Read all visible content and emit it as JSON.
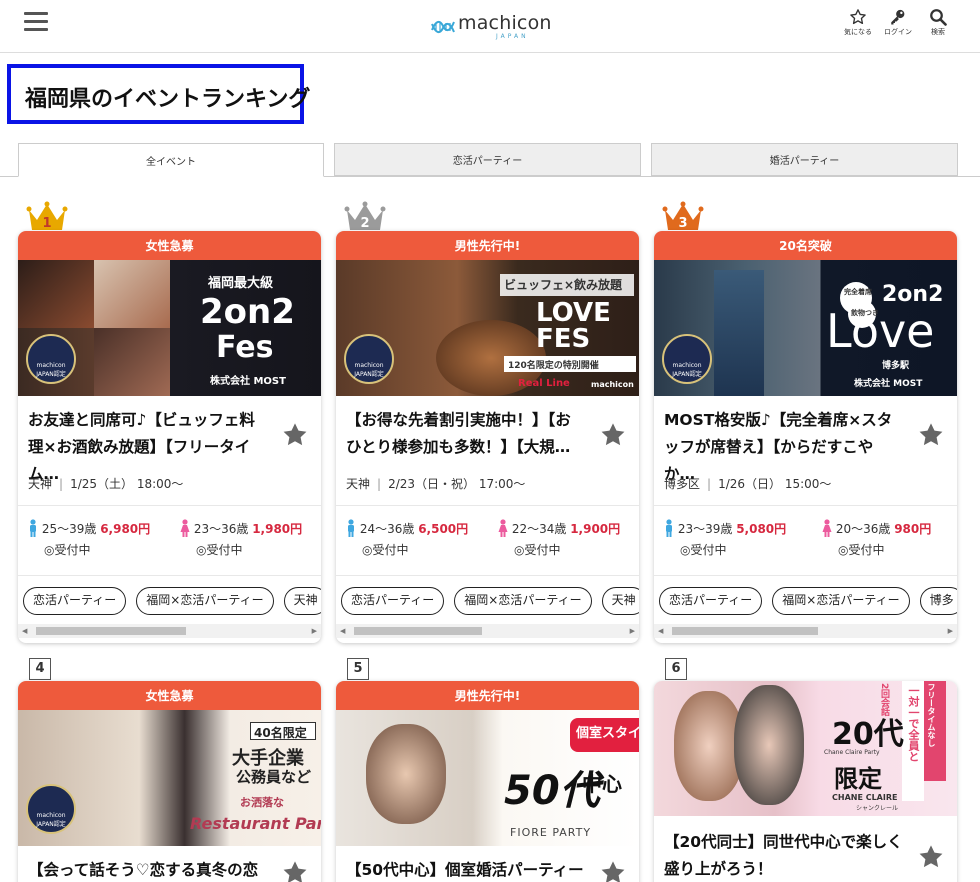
{
  "header": {
    "logo_text": "machicon",
    "logo_sub": "JAPAN",
    "icons": [
      {
        "name": "star-icon",
        "label": "気になる"
      },
      {
        "name": "key-icon",
        "label": "ログイン"
      },
      {
        "name": "search-icon",
        "label": "検索"
      }
    ]
  },
  "page_title": "福岡県のイベントランキング",
  "tabs": [
    {
      "label": "全イベント",
      "active": true
    },
    {
      "label": "恋活パーティー",
      "active": false
    },
    {
      "label": "婚活パーティー",
      "active": false
    }
  ],
  "cert_badge": {
    "line1": "machicon",
    "line2": "JAPAN認定"
  },
  "cards": [
    {
      "rank": "1",
      "banner": "女性急募",
      "image_text": [
        "福岡最大級",
        "2on2",
        "Fes",
        "株式会社 MOST"
      ],
      "title": "お友達と同席可♪【ビュッフェ料理×お酒飲み放題】【フリータイム…",
      "area": "天神",
      "date": "1/25（土） 18:00〜",
      "male_age": "25〜39歳",
      "male_price": "6,980円",
      "male_status": "◎受付中",
      "female_age": "23〜36歳",
      "female_price": "1,980円",
      "female_status": "◎受付中",
      "tags": [
        "恋活パーティー",
        "福岡×恋活パーティー",
        "天神"
      ]
    },
    {
      "rank": "2",
      "banner": "男性先行中!",
      "image_text": [
        "ビュッフェ×飲み放題",
        "LOVE",
        "FES",
        "120名限定の特別開催",
        "Real Line",
        "machicon"
      ],
      "title": "【お得な先着割引実施中！】【おひとり様参加も多数！】【大規…",
      "area": "天神",
      "date": "2/23（日・祝） 17:00〜",
      "male_age": "24〜36歳",
      "male_price": "6,500円",
      "male_status": "◎受付中",
      "female_age": "22〜34歳",
      "female_price": "1,900円",
      "female_status": "◎受付中",
      "tags": [
        "恋活パーティー",
        "福岡×恋活パーティー",
        "天神"
      ]
    },
    {
      "rank": "3",
      "banner": "20名突破",
      "image_text": [
        "完全着席",
        "飲物つき",
        "2on2",
        "Love",
        "博多駅",
        "株式会社 MOST"
      ],
      "title": "MOST格安版♪【完全着席×スタッフが席替え】【からだすこやか…",
      "area": "博多区",
      "date": "1/26（日） 15:00〜",
      "male_age": "23〜39歳",
      "male_price": "5,080円",
      "male_status": "◎受付中",
      "female_age": "20〜36歳",
      "female_price": "980円",
      "female_status": "◎受付中",
      "tags": [
        "恋活パーティー",
        "福岡×恋活パーティー",
        "博多"
      ]
    },
    {
      "rank": "4",
      "banner": "女性急募",
      "image_text": [
        "40名限定",
        "大手企業",
        "公務員など",
        "お洒落な",
        "Restaurant Party"
      ],
      "title": "【会って話そう♡恋する真冬の恋"
    },
    {
      "rank": "5",
      "banner": "男性先行中!",
      "image_text": [
        "個室スタイル",
        "50代",
        "中心",
        "FIORE PARTY"
      ],
      "title": "【50代中心】個室婚活パーティー"
    },
    {
      "rank": "6",
      "banner": "",
      "image_text": [
        "フリータイムなし",
        "一対一で全員と",
        "2回会話",
        "20代",
        "Chane Claire Party",
        "限定",
        "CHANE CLAIRE",
        "シャンクレール"
      ],
      "title": "【20代同士】同世代中心で楽しく盛り上がろう！"
    }
  ],
  "colors": {
    "banner": "#ee5a3c",
    "price": "#d6283f",
    "highlight_border": "#0a14e6",
    "crown_gold": "#e8a800",
    "crown_silver": "#9b9b9b",
    "crown_bronze": "#e06a1d",
    "male_icon": "#3ea7e0",
    "female_icon": "#ec5b9e"
  }
}
